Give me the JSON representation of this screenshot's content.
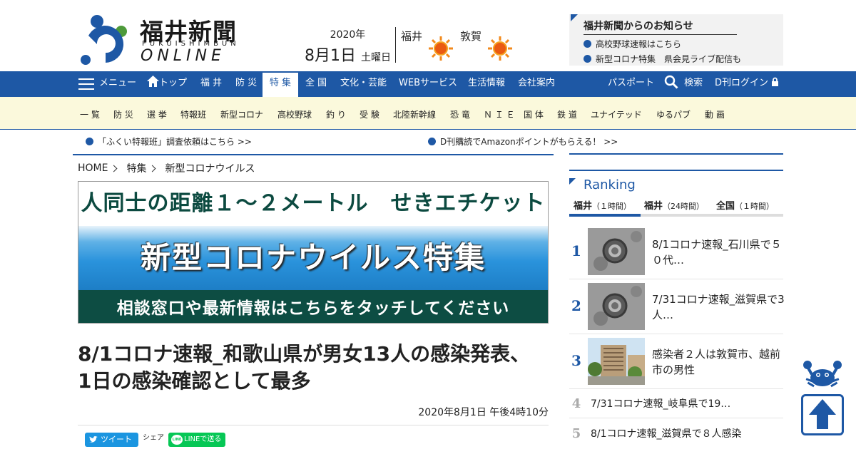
{
  "header": {
    "logo_title": "福井新聞",
    "logo_sub": "FUKUISHIMBUN",
    "logo_online": "ONLINE",
    "date_year": "2020年",
    "date_day": "8月1日",
    "date_weekday": "土曜日",
    "weather": [
      {
        "city": "福井",
        "icon": "sun-icon"
      },
      {
        "city": "敦賀",
        "icon": "sun-icon"
      }
    ],
    "notice": {
      "title": "福井新聞からのお知らせ",
      "items": [
        "高校野球速報はこちら",
        "新型コロナ特集　県会見ライブ配信も"
      ]
    }
  },
  "nav": {
    "menu": "メニュー",
    "top": "トップ",
    "items": [
      "福 井",
      "防 災",
      "特 集",
      "全 国",
      "文化・芸能",
      "WEBサービス",
      "生活情報",
      "会社案内"
    ],
    "passport": "パスポート",
    "search": "検索",
    "login": "D刊ログイン"
  },
  "subnav": [
    "一 覧",
    "防 災",
    "選 挙",
    "特報班",
    "新型コロナ",
    "高校野球",
    "釣 り",
    "受 験",
    "北陸新幹線",
    "恐 竜",
    "Ｎ Ｉ Ｅ",
    "国 体",
    "鉄 道",
    "ユナイテッド",
    "ゆるパブ",
    "動 画"
  ],
  "announcements": [
    "「ふくい特報班」調査依頼はこちら >>",
    "D刊購読でAmazonポイントがもらえる！ >>"
  ],
  "breadcrumb": [
    "HOME",
    "特集",
    "新型コロナウイルス"
  ],
  "banner": {
    "top": "人同士の距離１～２メートル　せきエチケット",
    "middle": "新型コロナウイルス特集",
    "bottom": "相談窓口や最新情報はこちらをタッチしてください"
  },
  "article": {
    "headline": "8/1コロナ速報_和歌山県が男女13人の感染発表、1日の感染確認として最多",
    "published": "2020年8月1日 午後4時10分",
    "tweet": "ツイート",
    "share": "シェア",
    "line": "LINEで送る"
  },
  "ranking": {
    "title": "Ranking",
    "tabs": [
      {
        "name": "福井",
        "period": "（１時間）"
      },
      {
        "name": "福井",
        "period": "（24時間）"
      },
      {
        "name": "全国",
        "period": "（１時間）"
      }
    ],
    "items": [
      {
        "rank": "1",
        "text": "8/1コロナ速報_石川県で５０代…",
        "thumb": "virus"
      },
      {
        "rank": "2",
        "text": "7/31コロナ速報_滋賀県で3人…",
        "thumb": "virus"
      },
      {
        "rank": "3",
        "text": "感染者２人は敦賀市、越前市の男性",
        "thumb": "building"
      },
      {
        "rank": "4",
        "text": "7/31コロナ速報_岐阜県で19…"
      },
      {
        "rank": "5",
        "text": "8/1コロナ速報_滋賀県で８人感染"
      }
    ]
  },
  "colors": {
    "brand": "#1e58a5",
    "subnav_bg": "#fbf9dc",
    "banner_dark": "#0d4d43"
  }
}
